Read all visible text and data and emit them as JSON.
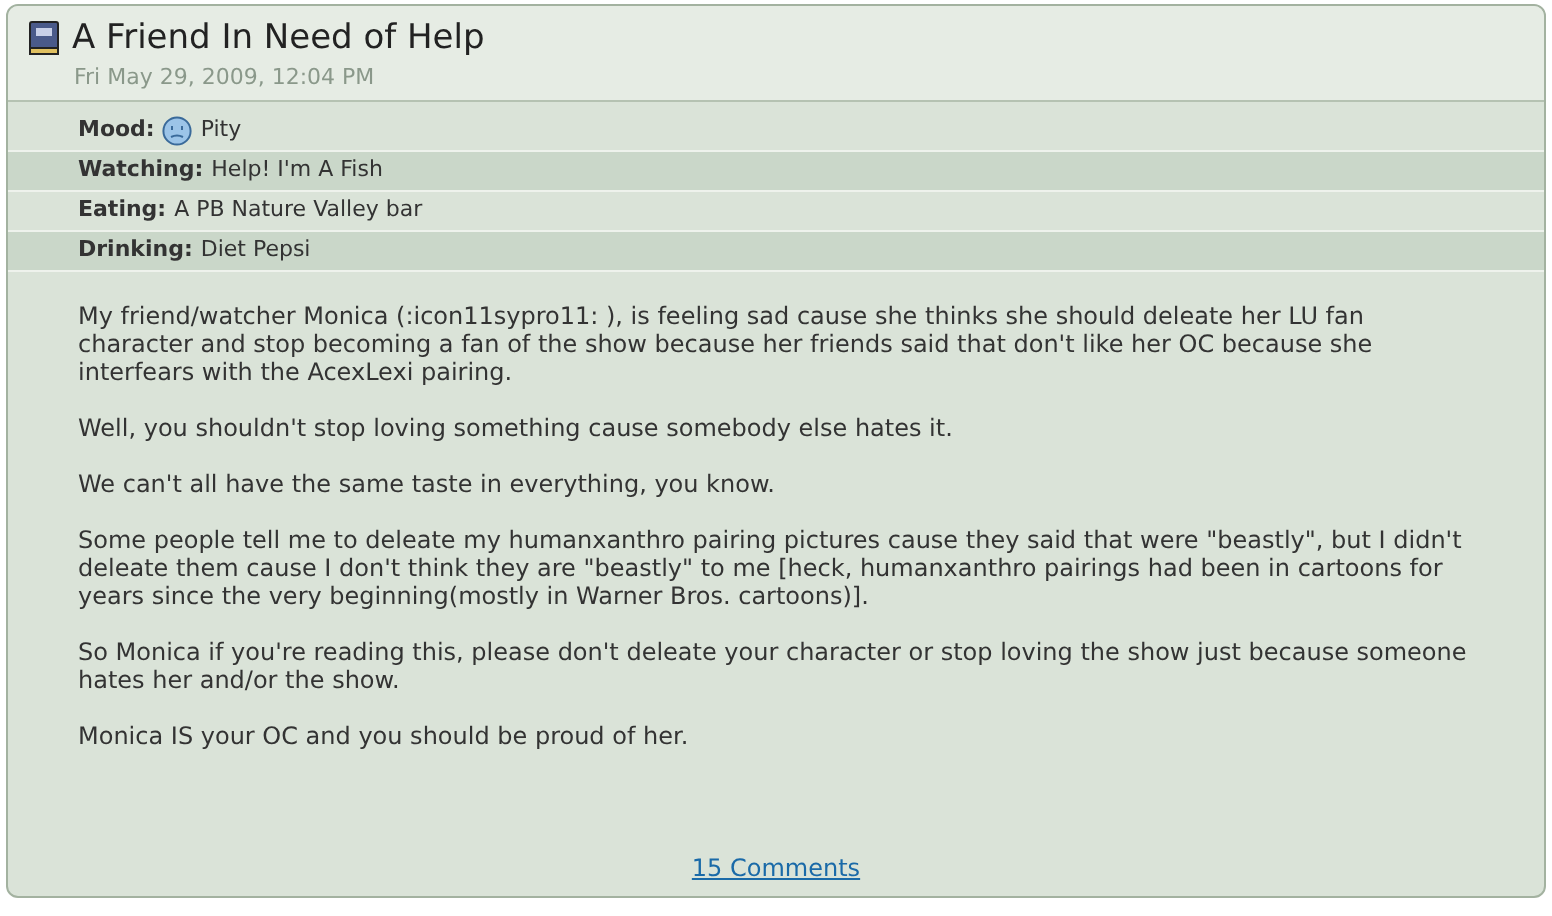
{
  "entry": {
    "title": "A Friend In Need of Help",
    "date": "Fri May 29, 2009, 12:04 PM"
  },
  "details": [
    {
      "kind": "mood",
      "label": "Mood:",
      "value": "Pity"
    },
    {
      "kind": "text",
      "label": "Watching:",
      "value": "Help! I'm A Fish"
    },
    {
      "kind": "text",
      "label": "Eating:",
      "value": "A PB Nature Valley bar"
    },
    {
      "kind": "text",
      "label": "Drinking:",
      "value": "Diet Pepsi"
    }
  ],
  "paragraphs": [
    "My friend/watcher Monica (:icon11sypro11: ), is feeling sad cause she thinks she should deleate her LU fan character and stop becoming a fan of the show because her friends said that don't like her OC because she interfears with the AcexLexi pairing.",
    "Well, you shouldn't stop loving something cause somebody else hates it.",
    "We can't all have the same taste in everything, you know.",
    "Some people tell me to deleate my humanxanthro pairing pictures cause they said that were \"beastly\", but I didn't deleate them cause I don't think they are \"beastly\" to me [heck, humanxanthro pairings had been in cartoons for years since the very beginning(mostly in Warner Bros. cartoons)].",
    "So Monica if you're reading this, please don't deleate your character or stop loving the show just because someone hates her and/or the show.",
    "Monica IS your OC and you should be proud of her."
  ],
  "comments_link": "15 Comments"
}
